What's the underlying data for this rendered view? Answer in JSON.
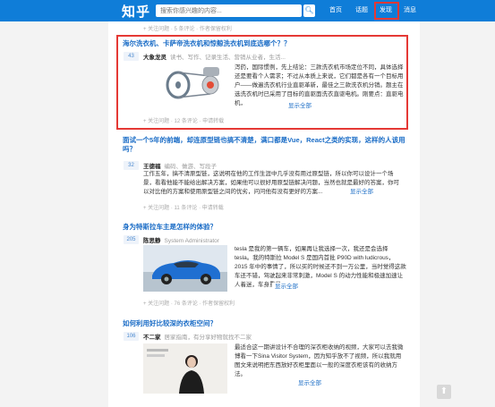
{
  "header": {
    "logo": "知乎",
    "search_placeholder": "搜索你感兴趣的内容...",
    "nav": [
      "首页",
      "话题",
      "发现",
      "消息"
    ]
  },
  "feed": {
    "top_meta": "+ 关注问题 · 5 条评论 · 作者保留权利",
    "items": [
      {
        "title": "海尔洗衣机、卡萨帝洗衣机和惊鲸洗衣机到底选哪个？？",
        "votes": "43",
        "author": "大象龙灵",
        "bio": "读书、写作、记录生活、营销从业者，生活...",
        "excerpt": "泻药，国际惯例，先上结论：三款洗衣机市场定位不同，具体选择还是要看个人需求；不过从本质上来说，它们都是各有一个目标用户——做遍洗衣机行业直驱革新，最佳之三款洗衣机分销。题主在选洗衣机时已采用了目标的直驱面洗衣直驱电机。刚要点：直驱电机，",
        "more": "显示全部",
        "meta": "+ 关注问题 · 12 条评论 · 申请转载"
      },
      {
        "title": "面试一个5年的前端，却连原型链也搞不清楚，满口都是Vue，React之类的实现，这样的人该用吗？",
        "votes": "32",
        "author": "王德福",
        "bio": "编码、做游、写段子",
        "excerpt": "工作五年，搞不清原型链，这说明在他的工作生涯中几乎没有用过原型链，所以你可以设计一个场景，看看他能不能给出解决方案，如果他可以很好用原型链解决问题，当然也就是最好的答案，你可以对比他的方案和使用原型链之间的优劣，问问他有没有更好的方案...",
        "more": "显示全部",
        "meta": "+ 关注问题 · 11 条评论 · 申请转载"
      },
      {
        "title": "身为特斯拉车主是怎样的体验？",
        "votes": "205",
        "author": "陈思静",
        "bio": "System Administrator",
        "excerpt": "tesla 是我的第一辆车，如果再让我选择一次，我还是会选择 tesla。我的特斯拉 Model S 是国内首批 P90D with ludicrous，2015 年中的事情了，所以买的时候还不到一万公里，当时觉得这款车还不错，驾驶起来非常刺激，Model S 的动力性能和极速加速让人着迷，车身重量...",
        "more": "显示全部",
        "meta": "+ 关注问题 · 76 条评论 · 作者保留权利"
      },
      {
        "title": "如何利用好比较深的衣柜空间？",
        "votes": "106",
        "author": "不二家",
        "bio": "居家指南，有分享好物就找不二家",
        "excerpt": "最适合这一期讲设计不合理的深衣柜收纳的视频，大家可以去我微博看一下Sina Visitor System，因为知乎放不了视频，所以我就用图文来说明把东西放好衣柜里面以一般的深度衣柜该有的收纳方法。",
        "more": "显示全部"
      }
    ]
  }
}
